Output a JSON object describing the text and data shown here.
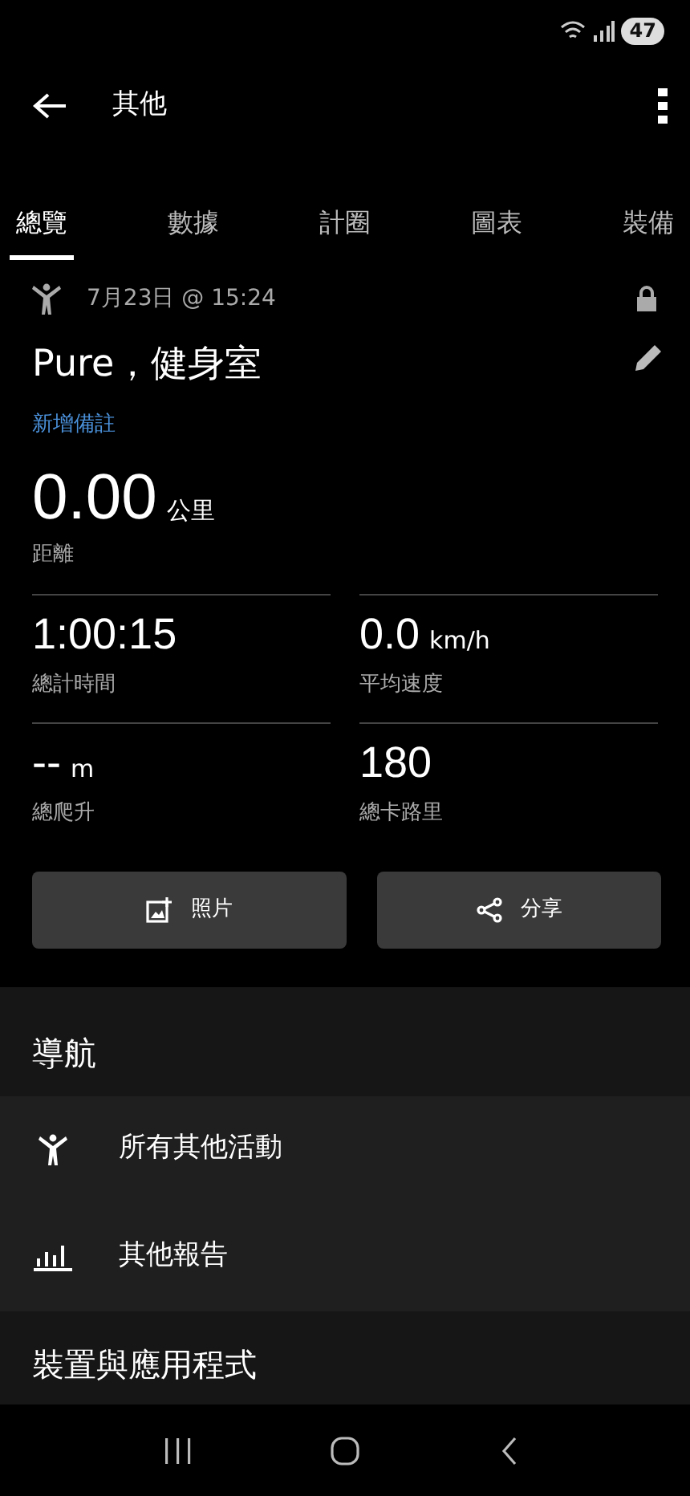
{
  "status_bar": {
    "battery": "47"
  },
  "toolbar": {
    "title": "其他"
  },
  "tabs": [
    {
      "label": "總覽",
      "selected": true
    },
    {
      "label": "數據",
      "selected": false
    },
    {
      "label": "計圈",
      "selected": false
    },
    {
      "label": "圖表",
      "selected": false
    },
    {
      "label": "裝備",
      "selected": false
    }
  ],
  "activity": {
    "date": "7月23日 @ 15:24",
    "title": "Pure，健身室",
    "add_note": "新增備註"
  },
  "distance": {
    "value": "0.00",
    "unit": "公里",
    "label": "距離"
  },
  "stats": [
    {
      "value": "1:00:15",
      "label": "總計時間"
    },
    {
      "value": "--",
      "unit": "m",
      "label": "總爬升"
    },
    {
      "value": "0.0",
      "unit": "km/h",
      "label": "平均速度"
    },
    {
      "value": "180",
      "label": "總卡路里"
    }
  ],
  "buttons": [
    {
      "kind": "photo",
      "label": "照片"
    },
    {
      "kind": "share",
      "label": "分享"
    }
  ],
  "navigation": {
    "heading": "導航",
    "items": [
      {
        "kind": "activity",
        "label": "所有其他活動"
      },
      {
        "kind": "report",
        "label": "其他報告"
      }
    ]
  },
  "next_section": {
    "heading": "裝置與應用程式"
  }
}
